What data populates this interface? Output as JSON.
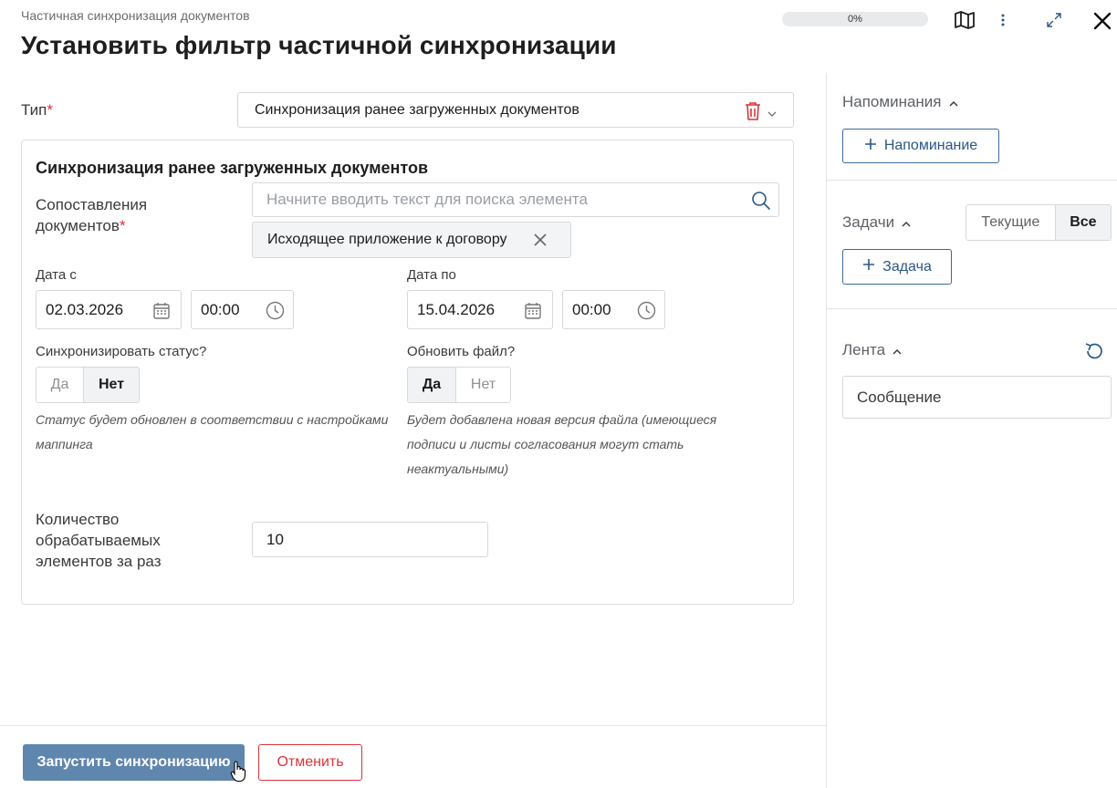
{
  "header": {
    "breadcrumb": "Частичная синхронизация документов",
    "title": "Установить фильтр частичной синхронизации",
    "progress": "0%",
    "progress_value": 0
  },
  "form": {
    "type_label": "Тип",
    "type_value": "Синхронизация ранее загруженных документов",
    "group_title": "Синхронизация ранее загруженных документов",
    "mapping_label_line1": "Сопоставления",
    "mapping_label_line2": "документов",
    "search_placeholder": "Начните вводить текст для поиска элемента",
    "mapping_chip": "Исходящее приложение к договору",
    "date_from_label": "Дата с",
    "date_from": "02.03.2026",
    "time_from": "00:00",
    "date_to_label": "Дата по",
    "date_to": "15.04.2026",
    "time_to": "00:00",
    "sync_status_label": "Синхронизировать статус?",
    "sync_status_options": [
      "Да",
      "Нет"
    ],
    "sync_status_selected": "Нет",
    "sync_status_hint_line1": "Статус будет обновлен в соответствии с настройками",
    "sync_status_hint_line2": "маппинга",
    "update_file_label": "Обновить файл?",
    "update_file_options": [
      "Да",
      "Нет"
    ],
    "update_file_selected": "Да",
    "update_file_hint_line1": "Будет добавлена новая версия файла (имеющиеся",
    "update_file_hint_line2": "подписи и листы согласования могут стать",
    "update_file_hint_line3": "неактуальными)",
    "count_label_line1": "Количество",
    "count_label_line2": "обрабатываемых",
    "count_label_line3": "элементов за раз",
    "count_value": "10"
  },
  "footer": {
    "start_label": "Запустить синхронизацию",
    "cancel_label": "Отменить"
  },
  "sidebar": {
    "reminders_title": "Напоминания",
    "add_reminder": "Напоминание",
    "tasks_title": "Задачи",
    "tasks_filter": [
      "Текущие",
      "Все"
    ],
    "tasks_filter_selected": "Все",
    "add_task": "Задача",
    "feed_title": "Лента",
    "message_placeholder": "Сообщение"
  },
  "colors": {
    "accent": "#5f86ad",
    "danger": "#d9343a",
    "link": "#2a5885"
  }
}
